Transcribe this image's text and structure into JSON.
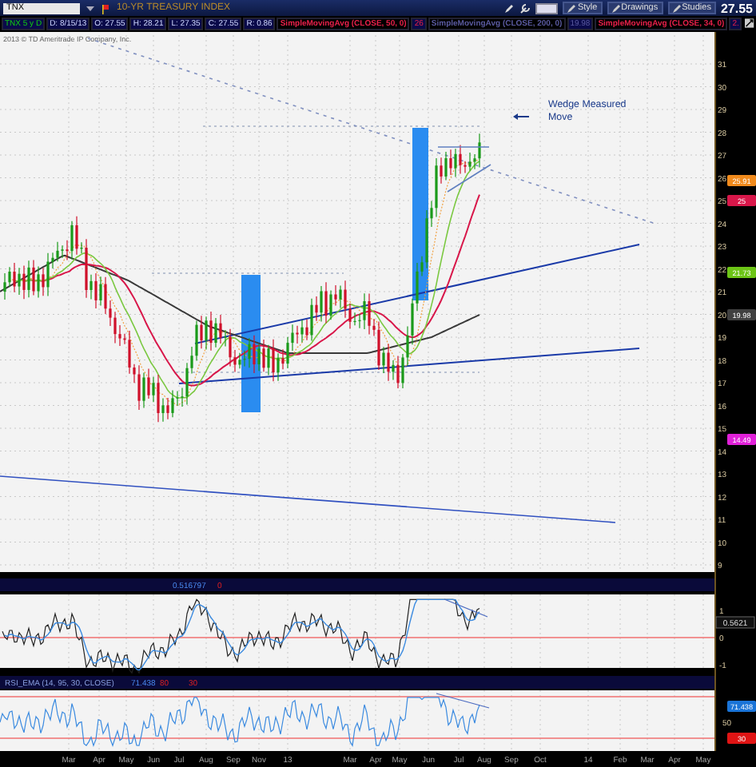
{
  "toolbar": {
    "symbol": "TNX",
    "title": "10-YR TREASURY INDEX",
    "buttons": [
      {
        "label": "Style"
      },
      {
        "label": "Drawings"
      },
      {
        "label": "Studies"
      }
    ],
    "last_price": "27.55"
  },
  "quote_bar": {
    "items": [
      "TNX 5 y D",
      "D: 8/15/13",
      "O: 27.55",
      "H: 28.21",
      "L: 27.35",
      "C: 27.55",
      "R: 0.86"
    ],
    "studies": [
      {
        "name": "SimpleMovingAvg (CLOSE, 50, 0)",
        "value": "26",
        "color": "#e8204a"
      },
      {
        "name": "SimpleMovingAvg (CLOSE, 200, 0)",
        "value": "19.98",
        "color": "#5a5aa0"
      },
      {
        "name": "SimpleMovingAvg (CLOSE, 34, 0)",
        "value": "2.",
        "color": "#e8204a"
      }
    ]
  },
  "price_pane": {
    "copyright": "2013 © TD Ameritrade IP Company, Inc.",
    "annotation": "Wedge Measured Move",
    "ticks": [
      "31",
      "30",
      "29",
      "28",
      "27",
      "26",
      "25",
      "24",
      "23",
      "22",
      "21",
      "20",
      "19",
      "18",
      "17",
      "16",
      "15",
      "14",
      "13",
      "12",
      "11",
      "10",
      "9"
    ],
    "tags": [
      {
        "text": "25.91",
        "color": "#f08a1c"
      },
      {
        "text": "25",
        "color": "#d8174a"
      },
      {
        "text": "21.73",
        "color": "#6cc416"
      },
      {
        "text": "19.98",
        "color": "#404040"
      },
      {
        "text": "14.49",
        "color": "#e020d8"
      }
    ]
  },
  "oscillator_pane": {
    "values": [
      "0.516797",
      "0"
    ],
    "ticks": [
      "1",
      "0",
      "-1"
    ],
    "tag": "0.5621"
  },
  "rsi_pane": {
    "title": "RSI_EMA (14, 95, 30, CLOSE)",
    "values": [
      "71.438",
      "80",
      "30"
    ],
    "ticks": [
      "50"
    ],
    "tags": [
      {
        "text": "71.438",
        "color": "#1a74d8"
      },
      {
        "text": "30",
        "color": "#e01414"
      }
    ]
  },
  "time_axis": [
    "Mar",
    "Apr",
    "May",
    "Jun",
    "Jul",
    "Aug",
    "Sep",
    "Nov",
    "13",
    "Mar",
    "Apr",
    "May",
    "Jun",
    "Jul",
    "Aug",
    "Sep",
    "Oct",
    "14",
    "Feb",
    "Mar",
    "Apr",
    "May"
  ]
}
